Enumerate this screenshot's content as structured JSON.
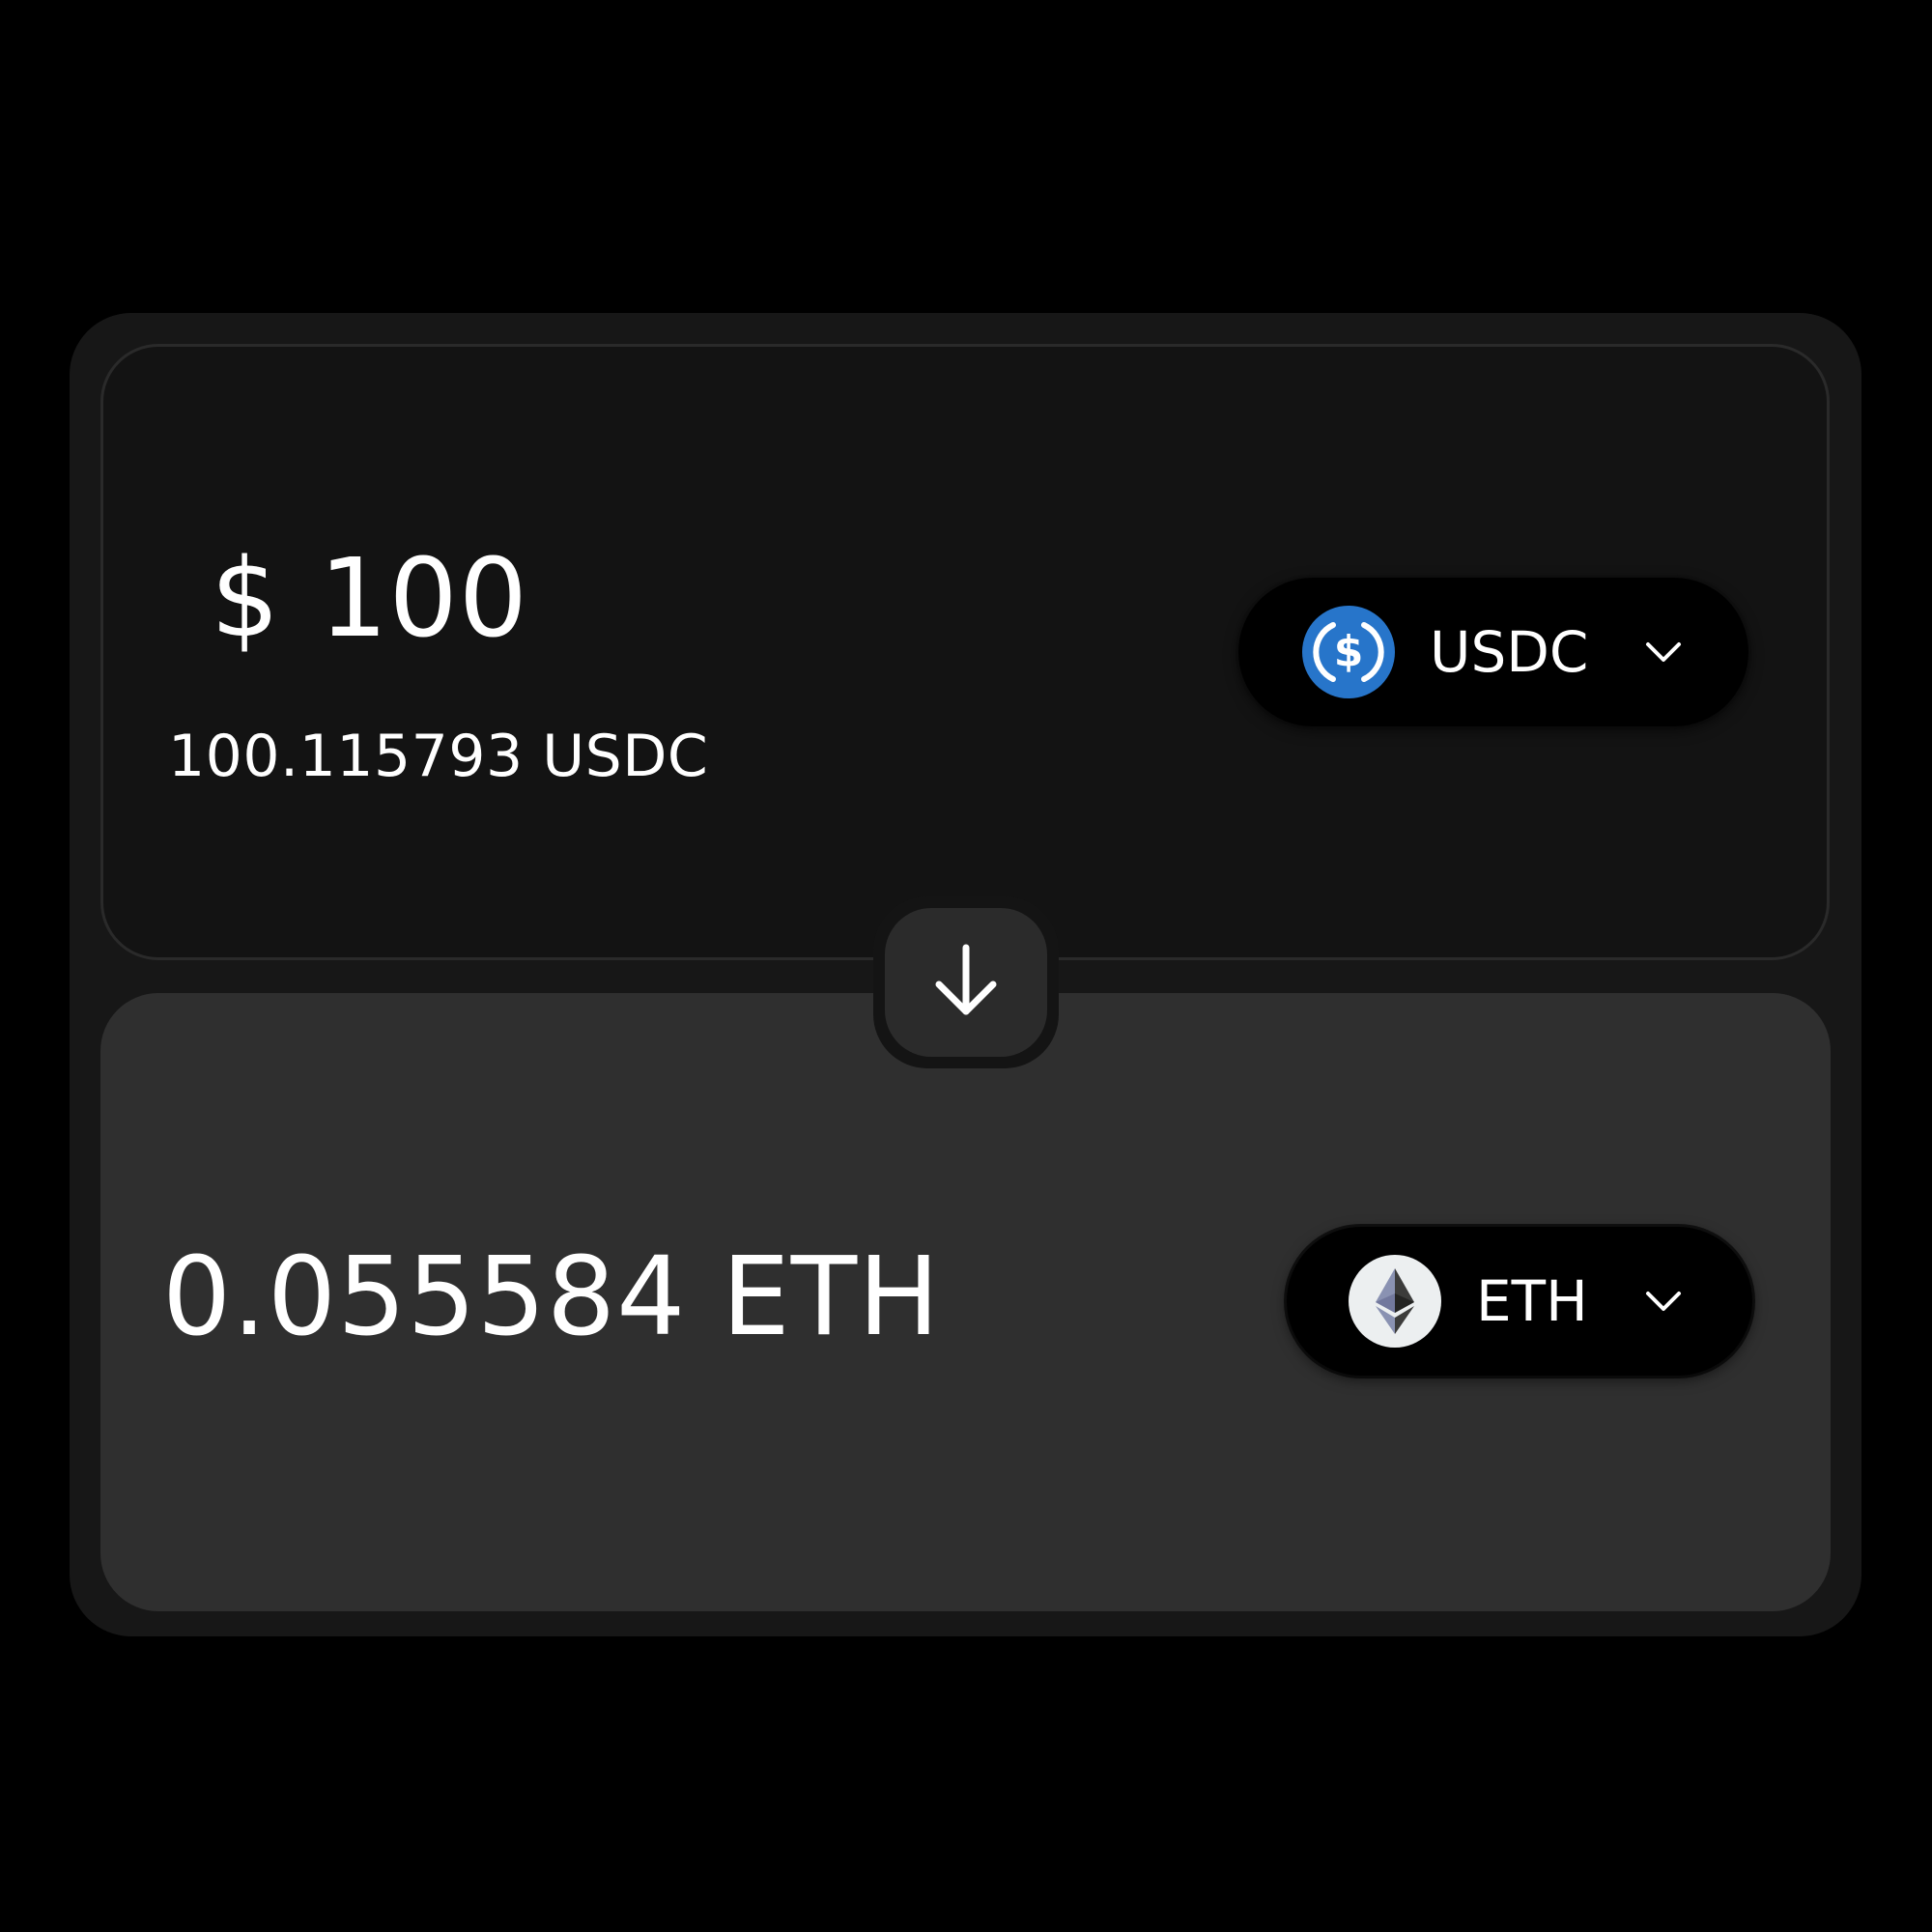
{
  "from": {
    "fiat_symbol": "$",
    "fiat_value": "100",
    "token_amount": "100.115793 USDC",
    "token": {
      "symbol": "USDC",
      "icon": "usdc-icon",
      "color": "#2775CA"
    }
  },
  "swap_direction": {
    "icon": "arrow-down-icon"
  },
  "to": {
    "token_amount": "0.055584 ETH",
    "token": {
      "symbol": "ETH",
      "icon": "eth-icon",
      "color": "#ECEFF0"
    }
  },
  "colors": {
    "page_background": "#000000",
    "widget_background": "#171717",
    "from_panel": "#131313",
    "to_panel": "#2F2F2F",
    "token_select": "#000000",
    "text": "#FFFFFF"
  }
}
